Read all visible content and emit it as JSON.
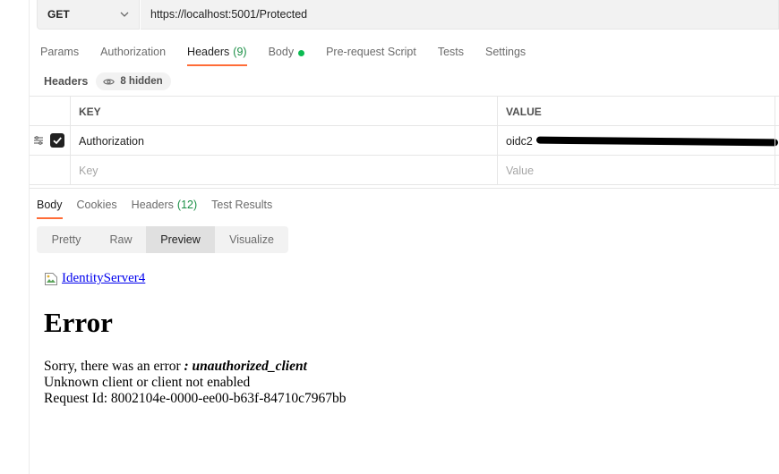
{
  "request": {
    "method": "GET",
    "url": "https://localhost:5001/Protected"
  },
  "request_tabs": [
    {
      "label": "Params"
    },
    {
      "label": "Authorization"
    },
    {
      "label": "Headers",
      "count": "(9)"
    },
    {
      "label": "Body"
    },
    {
      "label": "Pre-request Script"
    },
    {
      "label": "Tests"
    },
    {
      "label": "Settings"
    }
  ],
  "headers_section": {
    "label": "Headers",
    "hidden_label": "8 hidden"
  },
  "headers_table": {
    "key_header": "KEY",
    "value_header": "VALUE",
    "row": {
      "key": "Authorization",
      "value_prefix": "oidc2",
      "checked": true
    },
    "new_row": {
      "key_placeholder": "Key",
      "value_placeholder": "Value"
    }
  },
  "response_tabs": [
    {
      "label": "Body"
    },
    {
      "label": "Cookies"
    },
    {
      "label": "Headers",
      "count": "(12)"
    },
    {
      "label": "Test Results"
    }
  ],
  "view_modes": [
    "Pretty",
    "Raw",
    "Preview",
    "Visualize"
  ],
  "preview": {
    "brand_link": "IdentityServer4",
    "heading": "Error",
    "msg_prefix": "Sorry, there was an error ",
    "msg_error": ": unauthorized_client",
    "line2": "Unknown client or client not enabled",
    "line3": "Request Id: 8002104e-0000-ee00-b63f-84710c7967bb"
  },
  "colors": {
    "accent": "#ff6c37",
    "count_green": "#1a8f45",
    "body_dot": "#0cbb52",
    "link": "#0000ee"
  }
}
